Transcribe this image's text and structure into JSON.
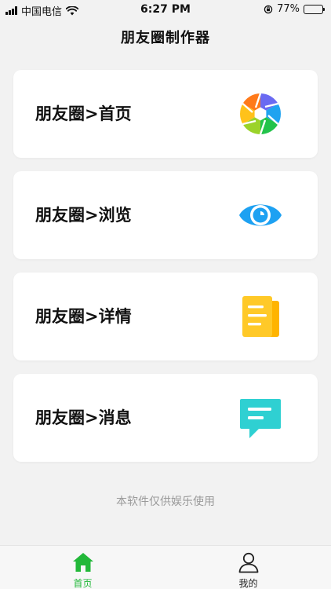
{
  "status_bar": {
    "carrier": "中国电信",
    "time": "6:27 PM",
    "battery": "77%",
    "battery_level": 0.77
  },
  "header": {
    "title": "朋友圈制作器"
  },
  "cards": [
    {
      "label": "朋友圈>首页",
      "icon": "camera-aperture-icon"
    },
    {
      "label": "朋友圈>浏览",
      "icon": "eye-icon"
    },
    {
      "label": "朋友圈>详情",
      "icon": "document-icon"
    },
    {
      "label": "朋友圈>消息",
      "icon": "chat-bubble-icon"
    }
  ],
  "footer": {
    "note": "本软件仅供娱乐使用"
  },
  "tab_bar": {
    "tabs": [
      {
        "label": "首页",
        "icon": "home-icon",
        "active": true
      },
      {
        "label": "我的",
        "icon": "user-icon",
        "active": false
      }
    ]
  },
  "colors": {
    "tab_active": "#22b839",
    "eye": "#1da1f2",
    "document": "#ffc21a",
    "chat": "#2fd0d2"
  }
}
